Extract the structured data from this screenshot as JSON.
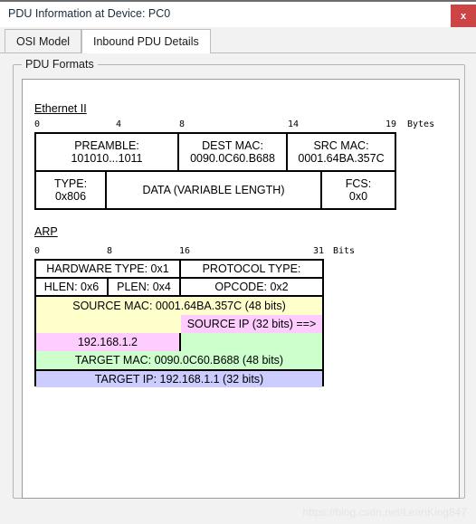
{
  "window": {
    "title": "PDU Information at Device: PC0",
    "close_label": "x"
  },
  "tabs": [
    {
      "label": "OSI Model",
      "active": false
    },
    {
      "label": "Inbound PDU Details",
      "active": true
    }
  ],
  "groupbox": {
    "label": "PDU Formats"
  },
  "ethernet": {
    "title": "Ethernet II",
    "unit_label": "Bytes",
    "ruler": [
      "0",
      "4",
      "8",
      "14",
      "19"
    ],
    "row1": [
      {
        "line1": "PREAMBLE:",
        "line2": "101010...1011"
      },
      {
        "line1": "DEST MAC:",
        "line2": "0090.0C60.B688"
      },
      {
        "line1": "SRC MAC:",
        "line2": "0001.64BA.357C"
      }
    ],
    "row2": [
      {
        "line1": "TYPE:",
        "line2": "0x806"
      },
      {
        "line1": "DATA (VARIABLE LENGTH)",
        "line2": ""
      },
      {
        "line1": "FCS:",
        "line2": "0x0"
      }
    ]
  },
  "arp": {
    "title": "ARP",
    "unit_label": "Bits",
    "ruler": [
      "0",
      "8",
      "16",
      "31"
    ],
    "hardware_type": "HARDWARE TYPE: 0x1",
    "protocol_type": "PROTOCOL TYPE:",
    "hlen": "HLEN: 0x6",
    "plen": "PLEN: 0x4",
    "opcode": "OPCODE: 0x2",
    "source_mac": "SOURCE MAC: 0001.64BA.357C (48 bits)",
    "source_ip_label": "SOURCE IP (32 bits) ==>",
    "source_ip_value": "192.168.1.2",
    "target_mac": "TARGET MAC: 0090.0C60.B688 (48 bits)",
    "target_ip": "TARGET IP: 192.168.1.1 (32 bits)",
    "colors": {
      "yellow": "#FFFFCC",
      "pink": "#FFCCFF",
      "green": "#CCFFCC",
      "blue": "#CCCCFF"
    }
  },
  "watermark": {
    "text": "https://blog.csdn.net/LeanKing847"
  }
}
